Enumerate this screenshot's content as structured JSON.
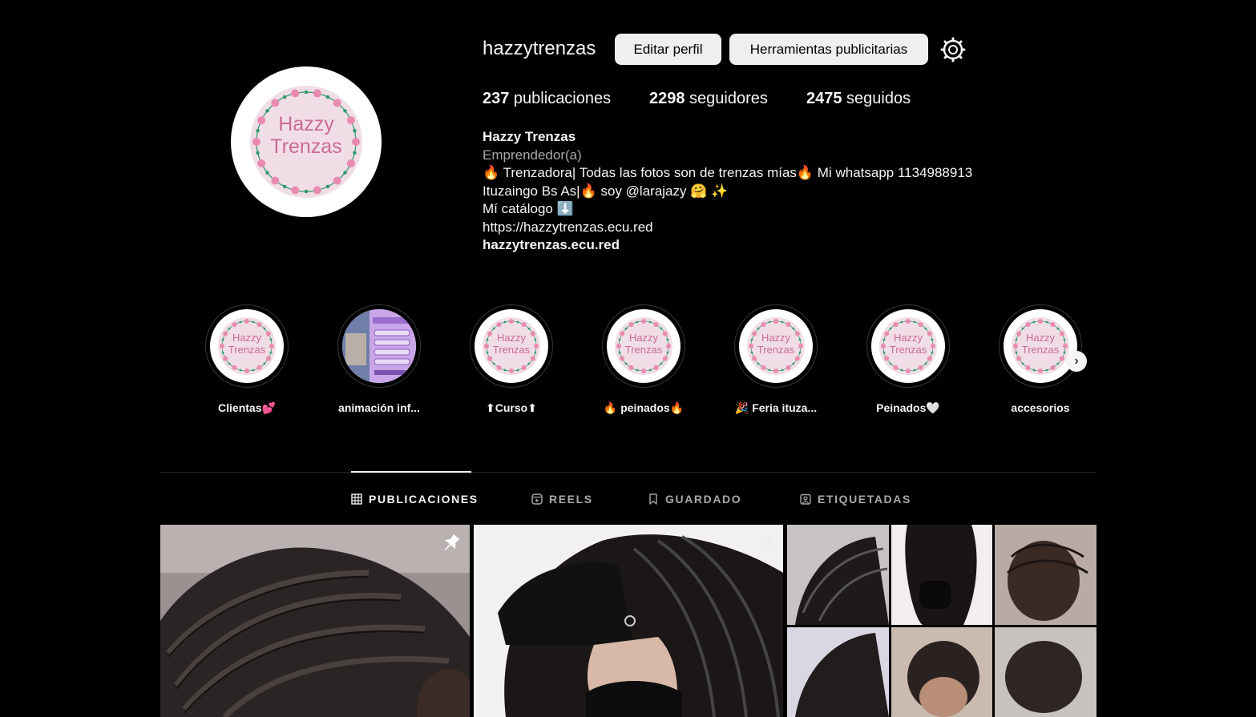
{
  "profile": {
    "username": "hazzytrenzas",
    "edit_button": "Editar perfil",
    "ads_button": "Herramientas publicitarias",
    "avatar_logo_text": [
      "Hazzy",
      "Trenzas"
    ],
    "stats": {
      "posts_count": "237",
      "posts_label": " publicaciones",
      "followers_count": "2298",
      "followers_label": " seguidores",
      "following_count": "2475",
      "following_label": " seguidos"
    },
    "bio": {
      "name": "Hazzy Trenzas",
      "category": "Emprendedor(a)",
      "line1": "🔥 Trenzadora| Todas las fotos son de trenzas mías🔥 Mi whatsapp 1134988913",
      "line2": "Ituzaingo Bs As|🔥 soy @larajazy 🤗 ✨",
      "line3": "Mí catálogo ⬇️",
      "line4": "https://hazzytrenzas.ecu.red",
      "link": "hazzytrenzas.ecu.red"
    }
  },
  "highlights": [
    {
      "label": "Clientas💕",
      "cover": "logo"
    },
    {
      "label": "animación inf...",
      "cover": "flyer"
    },
    {
      "label": "⬆Curso⬆",
      "cover": "logo"
    },
    {
      "label": "🔥 peinados🔥",
      "cover": "logo"
    },
    {
      "label": "🎉 Feria ituza...",
      "cover": "logo"
    },
    {
      "label": "Peinados🤍",
      "cover": "logo"
    },
    {
      "label": "accesorios",
      "cover": "logo"
    }
  ],
  "highlights_next_icon": "chevron-right-icon",
  "tabs": [
    {
      "label": "PUBLICACIONES",
      "icon": "grid-icon",
      "active": true
    },
    {
      "label": "REELS",
      "icon": "reels-icon",
      "active": false
    },
    {
      "label": "GUARDADO",
      "icon": "bookmark-icon",
      "active": false
    },
    {
      "label": "ETIQUETADAS",
      "icon": "tagged-icon",
      "active": false
    }
  ],
  "posts": [
    {
      "type": "photo",
      "pinned": true,
      "subject": "braids-closeup"
    },
    {
      "type": "photo",
      "pinned": true,
      "subject": "braids-with-bangs-mask"
    },
    {
      "type": "collage",
      "pinned": true,
      "subject": "braids-collage"
    }
  ],
  "colors": {
    "background": "#000000",
    "text": "#f5f5f5",
    "muted": "#a8a8a8",
    "button_bg": "#efefef",
    "logo_pink": "#e98bb0",
    "logo_green": "#2e9a6a"
  }
}
